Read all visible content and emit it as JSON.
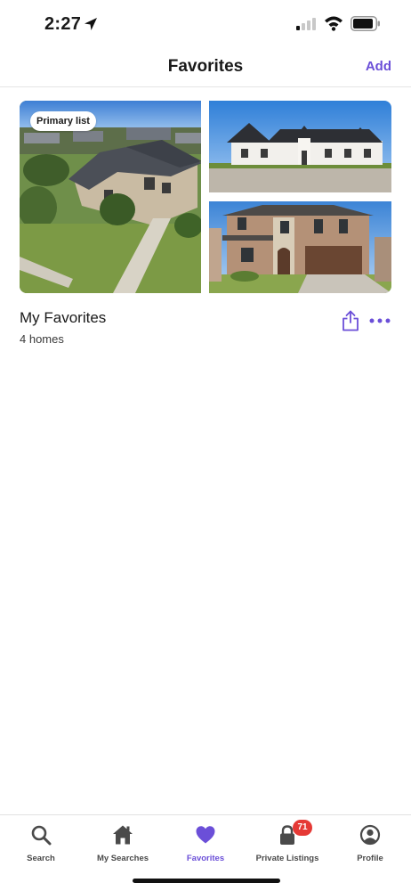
{
  "status_bar": {
    "time": "2:27"
  },
  "nav": {
    "title": "Favorites",
    "add_label": "Add"
  },
  "list": {
    "badge": "Primary list",
    "name": "My Favorites",
    "count": "4 homes"
  },
  "tabs": [
    {
      "label": "Search",
      "icon": "search-icon",
      "active": false
    },
    {
      "label": "My Searches",
      "icon": "house-icon",
      "active": false
    },
    {
      "label": "Favorites",
      "icon": "heart-icon",
      "active": true
    },
    {
      "label": "Private Listings",
      "icon": "lock-icon",
      "active": false,
      "badge": "71"
    },
    {
      "label": "Profile",
      "icon": "profile-icon",
      "active": false
    }
  ],
  "colors": {
    "accent": "#6b4fd8",
    "badge": "#e53935",
    "text": "#1a1a1a"
  }
}
